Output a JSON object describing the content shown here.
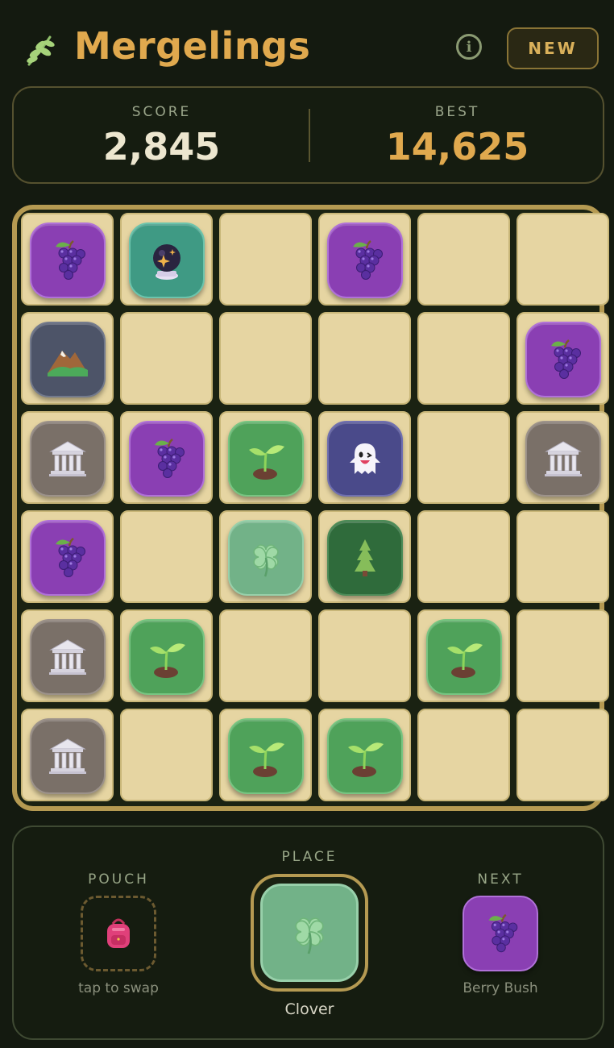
{
  "app": {
    "title": "Mergelings",
    "logo_icon": "leaf-sprig-icon",
    "brand_color": "#e0a94e"
  },
  "header": {
    "info_icon": "info-icon",
    "new_label": "NEW"
  },
  "scores": {
    "score_label": "SCORE",
    "score_value": "2,845",
    "best_label": "BEST",
    "best_value": "14,625"
  },
  "board": {
    "rows": 6,
    "cols": 6,
    "grid": [
      [
        "grape",
        "crystal",
        null,
        "grape",
        null,
        null
      ],
      [
        "mountain",
        null,
        null,
        null,
        null,
        "grape"
      ],
      [
        "temple",
        "grape",
        "sprout",
        "ghost",
        null,
        "temple"
      ],
      [
        "grape",
        null,
        "clover",
        "tree",
        null,
        null
      ],
      [
        "temple",
        "sprout",
        null,
        null,
        "sprout",
        null
      ],
      [
        "temple",
        null,
        "sprout",
        "sprout",
        null,
        null
      ]
    ],
    "piece_icons": {
      "grape": "grapes-icon",
      "crystal": "crystal-ball-icon",
      "mountain": "mountain-icon",
      "temple": "classical-building-icon",
      "sprout": "seedling-icon",
      "ghost": "ghost-icon",
      "clover": "four-leaf-clover-icon",
      "tree": "evergreen-tree-icon"
    }
  },
  "footer": {
    "pouch_label": "POUCH",
    "pouch_icon": "backpack-icon",
    "pouch_hint": "tap to swap",
    "place_label": "PLACE",
    "place_piece": "Clover",
    "place_icon": "four-leaf-clover-icon",
    "next_label": "NEXT",
    "next_piece": "Berry Bush",
    "next_icon": "grapes-icon"
  }
}
